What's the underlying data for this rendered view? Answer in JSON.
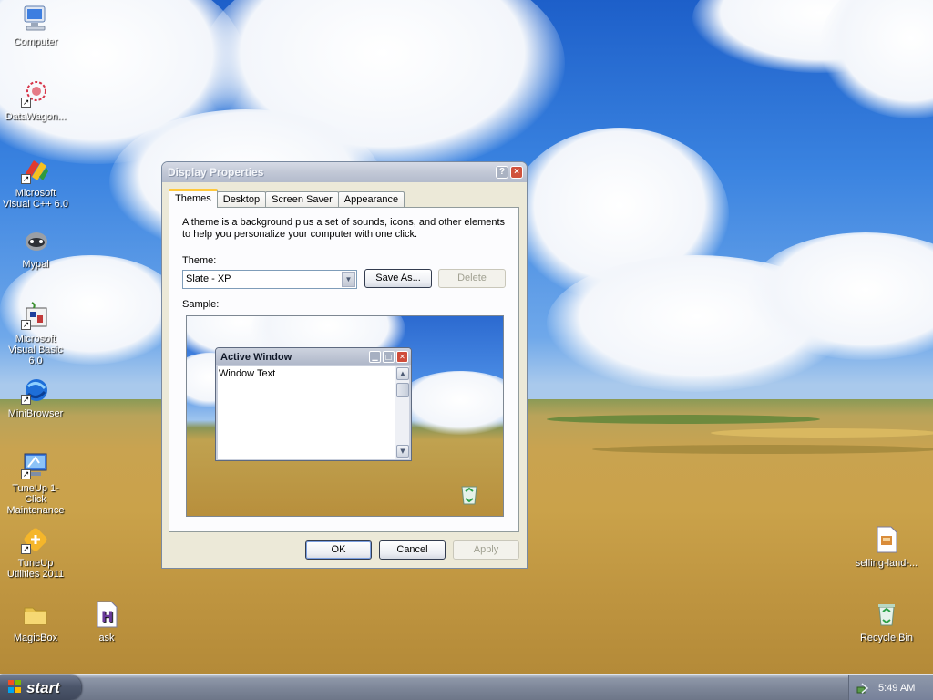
{
  "desktop": {
    "icons": [
      {
        "label": "Computer",
        "icon": "computer-icon"
      },
      {
        "label": "DataWagon...",
        "icon": "datawagon-icon"
      },
      {
        "label": "Microsoft Visual C++ 6.0",
        "icon": "visual-cpp-icon"
      },
      {
        "label": "Mypal",
        "icon": "mypal-icon"
      },
      {
        "label": "Microsoft Visual Basic 6.0",
        "icon": "visual-basic-icon"
      },
      {
        "label": "MiniBrowser",
        "icon": "minibrowser-icon"
      },
      {
        "label": "TuneUp 1-Click Maintenance",
        "icon": "tuneup-maintenance-icon"
      },
      {
        "label": "TuneUp Utilities 2011",
        "icon": "tuneup-utilities-icon"
      },
      {
        "label": "MagicBox",
        "icon": "folder-icon"
      },
      {
        "label": "ask",
        "icon": "text-file-icon"
      },
      {
        "label": "selling-land-...",
        "icon": "html-file-icon"
      },
      {
        "label": "Recycle Bin",
        "icon": "recycle-bin-icon"
      }
    ]
  },
  "dialog": {
    "title": "Display Properties",
    "help_glyph": "?",
    "close_glyph": "×",
    "tabs": [
      "Themes",
      "Desktop",
      "Screen Saver",
      "Appearance"
    ],
    "active_tab": "Themes",
    "description": "A theme is a background plus a set of sounds, icons, and other elements to help you personalize your computer with one click.",
    "theme_label": "Theme:",
    "theme_value": "Slate - XP",
    "save_as_label": "Save As...",
    "delete_label": "Delete",
    "sample_label": "Sample:",
    "preview": {
      "window_title": "Active Window",
      "window_text": "Window Text"
    },
    "ok_label": "OK",
    "cancel_label": "Cancel",
    "apply_label": "Apply"
  },
  "taskbar": {
    "start_label": "start",
    "clock": "5:49 AM"
  },
  "colors": {
    "dialog_face": "#ece9d8",
    "titlebar": "#c2c8d6",
    "taskbar": "#7c8597",
    "active_tab_accent": "#ffc83c"
  }
}
